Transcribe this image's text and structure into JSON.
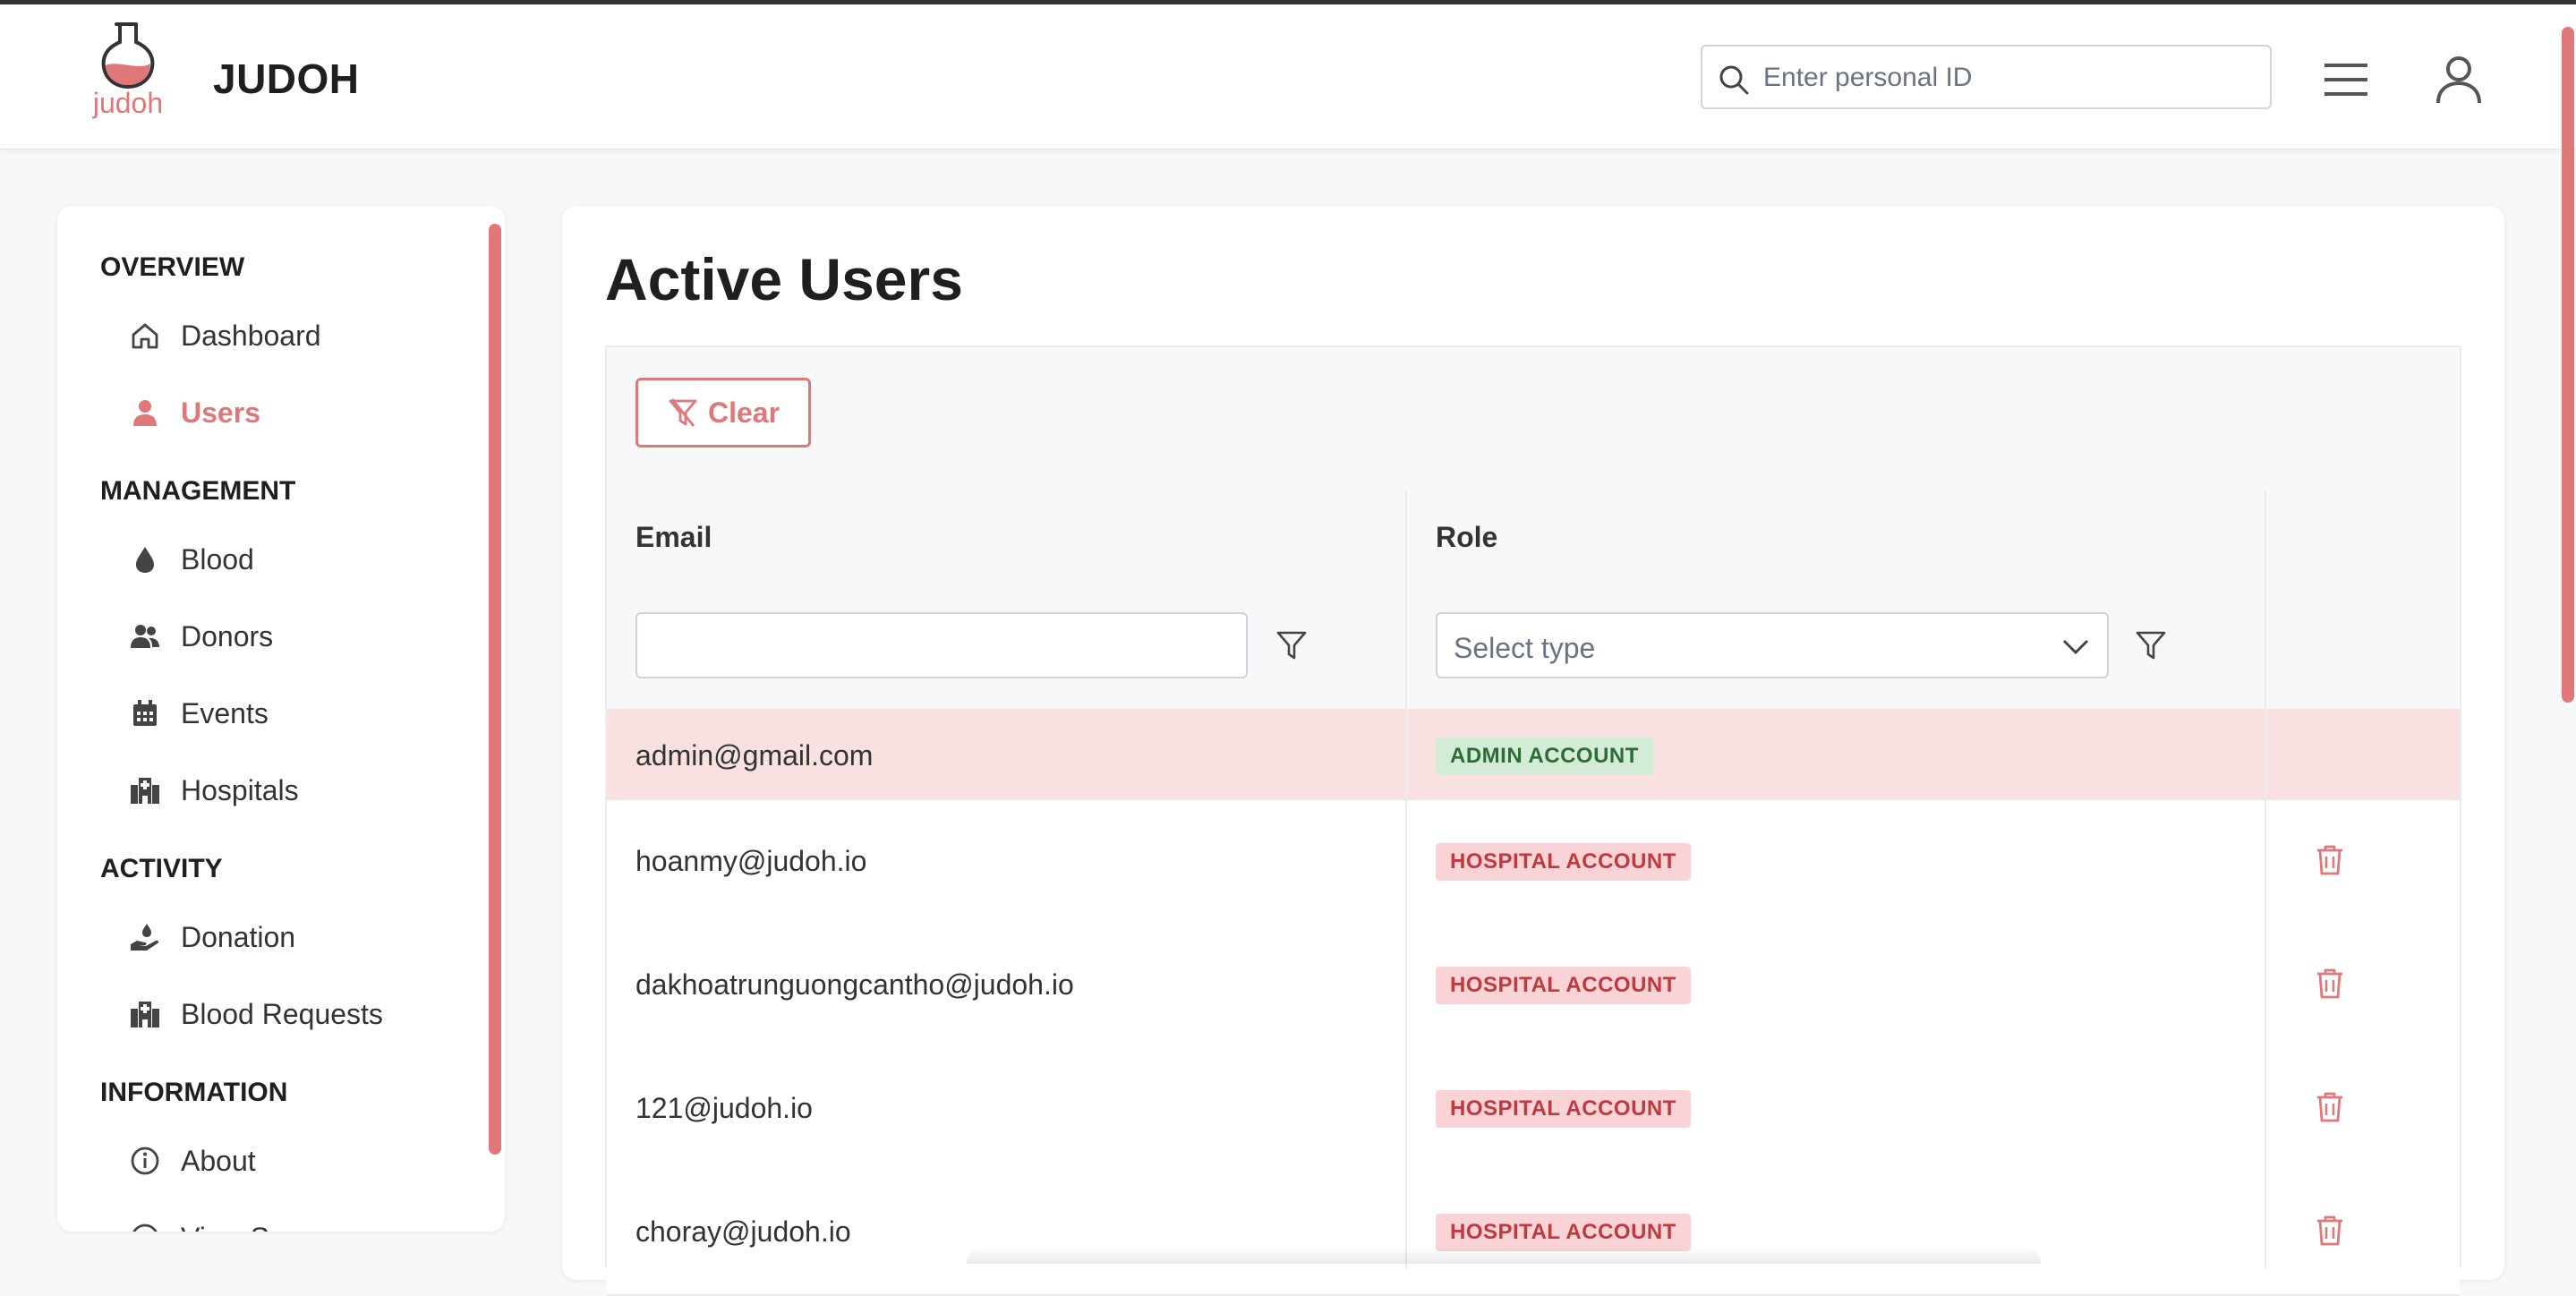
{
  "app": {
    "logo_text": "judoh",
    "title": "JUDOH"
  },
  "header": {
    "search_placeholder": "Enter personal ID",
    "menu_icon": "hamburger-icon",
    "user_icon": "user-icon"
  },
  "sidebar": {
    "sections": [
      {
        "title": "OVERVIEW",
        "items": [
          {
            "label": "Dashboard",
            "icon": "home-icon"
          },
          {
            "label": "Users",
            "icon": "user-icon",
            "active": true
          }
        ]
      },
      {
        "title": "MANAGEMENT",
        "items": [
          {
            "label": "Blood",
            "icon": "drop-icon"
          },
          {
            "label": "Donors",
            "icon": "users-icon"
          },
          {
            "label": "Events",
            "icon": "calendar-icon"
          },
          {
            "label": "Hospitals",
            "icon": "hospital-icon"
          }
        ]
      },
      {
        "title": "ACTIVITY",
        "items": [
          {
            "label": "Donation",
            "icon": "hand-drop-icon"
          },
          {
            "label": "Blood Requests",
            "icon": "hospital-icon"
          }
        ]
      },
      {
        "title": "INFORMATION",
        "items": [
          {
            "label": "About",
            "icon": "info-icon"
          },
          {
            "label": "View Source",
            "icon": "code-icon"
          }
        ]
      }
    ]
  },
  "main": {
    "title": "Active Users",
    "clear_label": "Clear",
    "columns": [
      "Email",
      "Role"
    ],
    "email_filter_value": "",
    "role_filter_placeholder": "Select type",
    "rows": [
      {
        "email": "admin@gmail.com",
        "role": "ADMIN ACCOUNT",
        "highlighted": true,
        "deletable": false
      },
      {
        "email": "hoanmy@judoh.io",
        "role": "HOSPITAL ACCOUNT",
        "deletable": true
      },
      {
        "email": "dakhoatrunguongcantho@judoh.io",
        "role": "HOSPITAL ACCOUNT",
        "deletable": true
      },
      {
        "email": "121@judoh.io",
        "role": "HOSPITAL ACCOUNT",
        "deletable": true
      },
      {
        "email": "choray@judoh.io",
        "role": "HOSPITAL ACCOUNT",
        "deletable": true
      }
    ]
  },
  "colors": {
    "accent": "#e0787a",
    "admin_badge_bg": "#d3ecd5",
    "admin_badge_text": "#2e6b35",
    "hospital_badge_bg": "#f9d3d5",
    "hospital_badge_text": "#c0393f",
    "highlight_row": "#f9e1e2"
  }
}
